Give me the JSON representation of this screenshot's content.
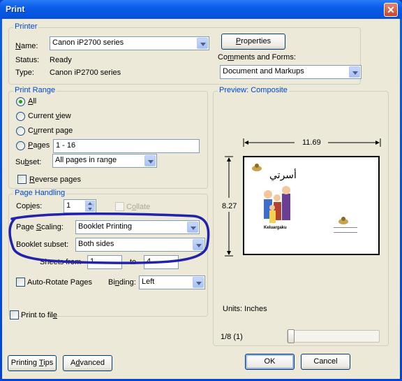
{
  "window": {
    "title": "Print",
    "close_glyph": "✕"
  },
  "printer": {
    "legend": "Printer",
    "name_label": "Name:",
    "name_value": "Canon iP2700 series",
    "status_label": "Status:",
    "status_value": "Ready",
    "type_label": "Type:",
    "type_value": "Canon iP2700 series",
    "properties_button": "Properties",
    "comments_label": "Comments and Forms:",
    "comments_value": "Document and Markups"
  },
  "print_range": {
    "legend": "Print Range",
    "all": "All",
    "current_view": "Current view",
    "current_page": "Current page",
    "pages": "Pages",
    "pages_value": "1 - 16",
    "subset_label": "Subset:",
    "subset_value": "All pages in range",
    "reverse_pages": "Reverse pages",
    "selected": "all"
  },
  "page_handling": {
    "legend": "Page Handling",
    "copies_label": "Copies:",
    "copies_value": "1",
    "collate": "Collate",
    "page_scaling_label": "Page Scaling:",
    "page_scaling_value": "Booklet Printing",
    "booklet_subset_label": "Booklet subset:",
    "booklet_subset_value": "Both sides",
    "sheets_from_label": "Sheets from",
    "sheets_from_value": "1",
    "to_label": "to",
    "sheets_to_value": "4",
    "auto_rotate": "Auto-Rotate Pages",
    "binding_label": "Binding:",
    "binding_value": "Left"
  },
  "preview": {
    "legend": "Preview: Composite",
    "width_value": "11.69",
    "height_value": "8.27",
    "page_title": "أسرتي",
    "page_caption": "Keluargaku",
    "units": "Units: Inches",
    "page_counter": "1/8 (1)",
    "slider_position": 0
  },
  "print_to_file": "Print to file",
  "buttons": {
    "printing_tips": "Printing Tips",
    "advanced": "Advanced",
    "ok": "OK",
    "cancel": "Cancel"
  },
  "colors": {
    "group_legend": "#0046d5",
    "annotation": "#2222aa",
    "title_bar": "#0a5de9"
  }
}
